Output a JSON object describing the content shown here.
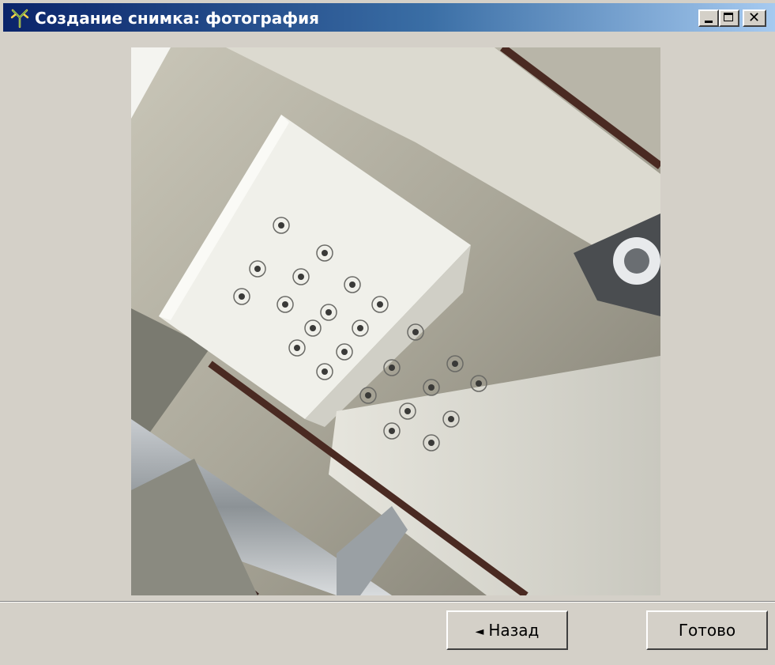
{
  "window": {
    "title": "Создание снимка: фотография",
    "controls": {
      "minimize": "minimize-icon",
      "maximize": "maximize-icon",
      "close": "close-icon"
    }
  },
  "photo": {
    "subject": "ceiling ventilation duct with perforated air diffuser panels"
  },
  "footer": {
    "back_arrow": "◄",
    "back_label": "Назад",
    "done_label": "Готово"
  },
  "colors": {
    "titlebar_start": "#0a246a",
    "titlebar_end": "#a6caf0",
    "window_bg": "#d4d0c8"
  }
}
